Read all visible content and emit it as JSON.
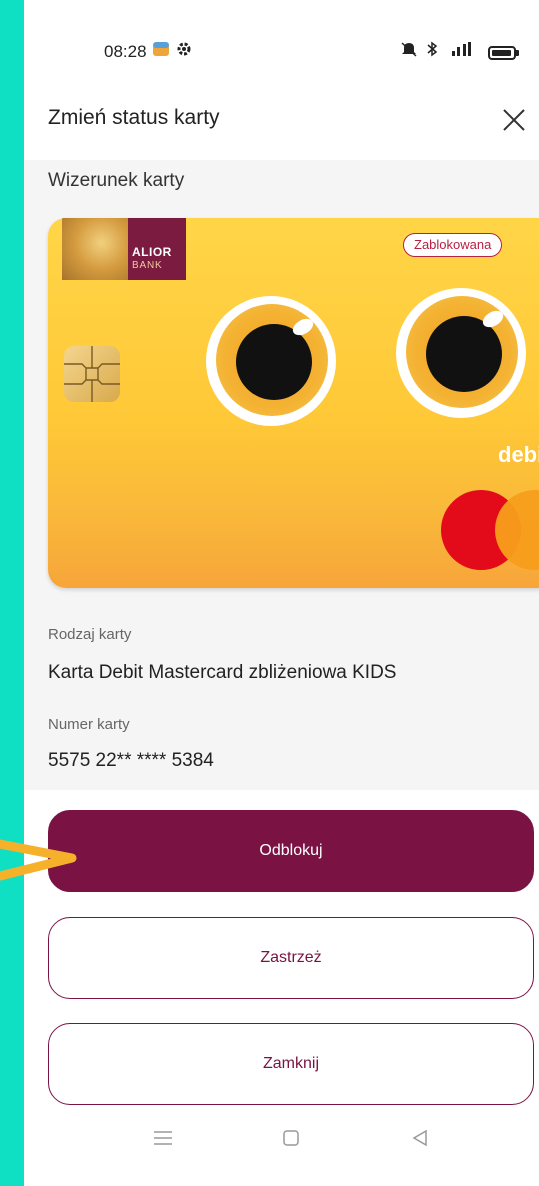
{
  "status_bar": {
    "time": "08:28",
    "icons": [
      "storage-icon",
      "gear-icon",
      "mute-icon",
      "bluetooth-icon",
      "signal-icon",
      "battery-icon"
    ]
  },
  "header": {
    "title": "Zmień status karty"
  },
  "card_section": {
    "label": "Wizerunek karty"
  },
  "card": {
    "bank_name_line1": "ALIOR",
    "bank_name_line2": "BANK",
    "status_badge": "Zablokowana",
    "type_text": "debit"
  },
  "details": {
    "type_label": "Rodzaj karty",
    "type_value": "Karta Debit Mastercard zbliżeniowa KIDS",
    "number_label": "Numer karty",
    "number_value": "5575 22** **** 5384"
  },
  "actions": {
    "unblock": "Odblokuj",
    "reserve": "Zastrzeż",
    "close": "Zamknij"
  },
  "colors": {
    "accent": "#7a1244",
    "background_frame": "#0fe0c4",
    "annotation_arrow": "#f6b12a"
  }
}
